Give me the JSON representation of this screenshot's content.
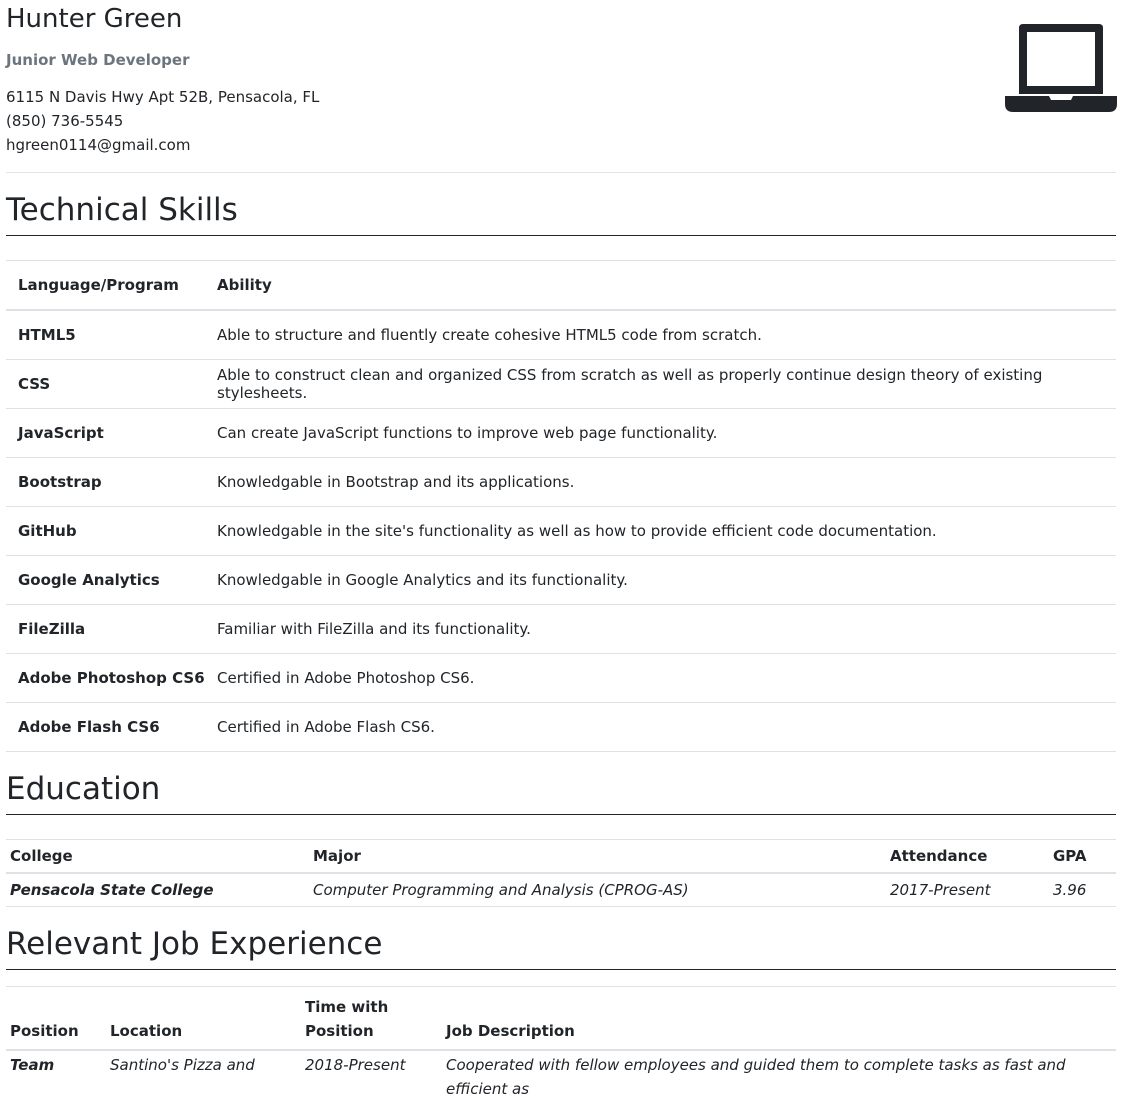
{
  "header": {
    "name": "Hunter Green",
    "title": "Junior Web Developer",
    "address": "6115 N Davis Hwy Apt 52B, Pensacola, FL",
    "phone": "(850) 736-5545",
    "email": "hgreen0114@gmail.com",
    "icon": "laptop-icon"
  },
  "skills": {
    "heading": "Technical Skills",
    "columns": [
      "Language/Program",
      "Ability"
    ],
    "rows": [
      [
        "HTML5",
        "Able to structure and fluently create cohesive HTML5 code from scratch."
      ],
      [
        "CSS",
        "Able to construct clean and organized CSS from scratch as well as properly continue design theory of existing stylesheets."
      ],
      [
        "JavaScript",
        "Can create JavaScript functions to improve web page functionality."
      ],
      [
        "Bootstrap",
        "Knowledgable in Bootstrap and its applications."
      ],
      [
        "GitHub",
        "Knowledgable in the site's functionality as well as how to provide efficient code documentation."
      ],
      [
        "Google Analytics",
        "Knowledgable in Google Analytics and its functionality."
      ],
      [
        "FileZilla",
        "Familiar with FileZilla and its functionality."
      ],
      [
        "Adobe Photoshop CS6",
        "Certified in Adobe Photoshop CS6."
      ],
      [
        "Adobe Flash CS6",
        "Certified in Adobe Flash CS6."
      ]
    ]
  },
  "education": {
    "heading": "Education",
    "columns": [
      "College",
      "Major",
      "Attendance",
      "GPA"
    ],
    "rows": [
      [
        "Pensacola State College",
        "Computer Programming and Analysis (CPROG-AS)",
        "2017-Present",
        "3.96"
      ]
    ]
  },
  "jobs": {
    "heading": "Relevant Job Experience",
    "columns": [
      "Position",
      "Location",
      "Time with Position",
      "Job Description"
    ],
    "rows": [
      [
        "Team",
        "Santino's Pizza and",
        "2018-Present",
        "Cooperated with fellow employees and guided them to complete tasks as fast and efficient as"
      ]
    ]
  }
}
